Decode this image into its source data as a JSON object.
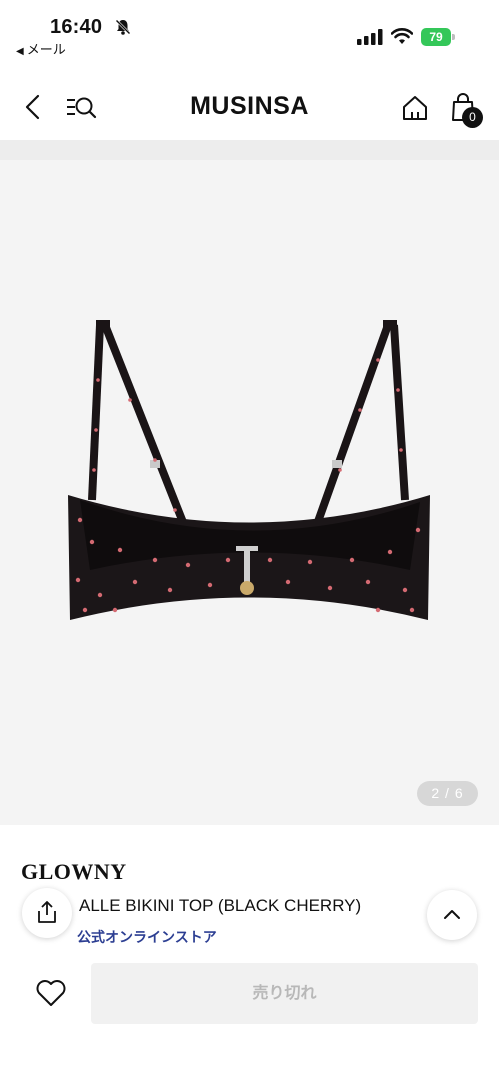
{
  "status_bar": {
    "time": "16:40",
    "back_app_label": "メール",
    "battery_level": "79",
    "icons": [
      "bell-slash-icon",
      "signal-icon",
      "wifi-icon",
      "battery-icon"
    ]
  },
  "nav": {
    "logo": "MUSINSA",
    "cart_count": "0",
    "icons": [
      "back-icon",
      "menu-search-icon",
      "home-icon",
      "cart-icon"
    ]
  },
  "gallery": {
    "indicator": "2 / 6",
    "current_page": 2,
    "total_pages": 6,
    "background": "#f4f4f4"
  },
  "product": {
    "brand": "GLOWNY",
    "name": "ALLE BIKINI TOP (BLACK CHERRY)",
    "store": "公式オンラインストア",
    "store_color": "#2c3e92"
  },
  "actions": {
    "soldout_label": "売り切れ",
    "icons": [
      "heart-icon",
      "share-icon",
      "chevron-up-icon"
    ]
  }
}
